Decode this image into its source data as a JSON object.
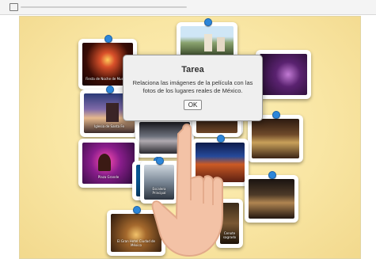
{
  "dialog": {
    "title": "Tarea",
    "message": "Relaciona las imágenes de la película con las fotos de los lugares reales de México.",
    "ok_label": "OK"
  },
  "cards": [
    {
      "caption": "Fiesta de Noche de Muertos",
      "pinned": true
    },
    {
      "caption": "",
      "pinned": true
    },
    {
      "caption": "",
      "pinned": false
    },
    {
      "caption": "",
      "pinned": true
    },
    {
      "caption": "",
      "pinned": true
    },
    {
      "caption": "Iglesia de Santa Fe",
      "pinned": true
    },
    {
      "caption": "",
      "pinned": false
    },
    {
      "caption": "",
      "pinned": false
    },
    {
      "caption": "Plaza Grande",
      "pinned": false
    },
    {
      "caption": "",
      "pinned": true
    },
    {
      "caption": "",
      "pinned": true
    },
    {
      "caption": "Museo de Arte",
      "pinned": true
    },
    {
      "caption": "Cenote sagrado",
      "pinned": false
    },
    {
      "caption": "Escalera Principal",
      "pinned": true
    },
    {
      "caption": "Biblioteca central",
      "pinned": true
    },
    {
      "caption": "",
      "pinned": false
    },
    {
      "caption": "El Gran Hotel Ciudad de México",
      "pinned": true
    }
  ],
  "colors": {
    "board": "#f9e6a4",
    "pin": "#2d86d9"
  }
}
